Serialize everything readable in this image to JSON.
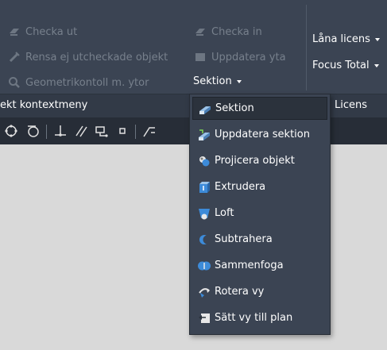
{
  "ribbon": {
    "left_items": [
      {
        "label": "Checka ut",
        "icon": "checkout-icon"
      },
      {
        "label": "Rensa ej utcheckade objekt",
        "icon": "clear-icon"
      },
      {
        "label": "Geometrikontoll m. ytor",
        "icon": "magnifier-icon"
      }
    ],
    "middle_items": [
      {
        "label": "Checka in",
        "icon": "checkin-icon"
      },
      {
        "label": "Uppdatera yta",
        "icon": "update-surface-icon"
      }
    ],
    "sektion_button": "Sektion",
    "right_items": [
      {
        "label": "Låna licens"
      },
      {
        "label": "Focus Total"
      }
    ]
  },
  "panel_labels": {
    "left": "ekt kontextmeny",
    "right": "Licens"
  },
  "menu": {
    "items": [
      {
        "label": "Sektion",
        "icon": "section-icon",
        "selected": true
      },
      {
        "label": "Uppdatera sektion",
        "icon": "update-section-icon",
        "selected": false
      },
      {
        "label": "Projicera objekt",
        "icon": "project-object-icon",
        "selected": false
      },
      {
        "label": "Extrudera",
        "icon": "extrude-icon",
        "selected": false
      },
      {
        "label": "Loft",
        "icon": "loft-icon",
        "selected": false
      },
      {
        "label": "Subtrahera",
        "icon": "subtract-icon",
        "selected": false
      },
      {
        "label": "Sammenfoga",
        "icon": "union-icon",
        "selected": false
      },
      {
        "label": "Rotera vy",
        "icon": "rotate-view-icon",
        "selected": false
      },
      {
        "label": "Sätt vy till plan",
        "icon": "set-view-plan-icon",
        "selected": false
      }
    ]
  },
  "colors": {
    "ribbon_bg": "#3b4453",
    "panelbar_bg": "#323a47",
    "toolbar_bg": "#272d37",
    "canvas_bg": "#d9d9d9",
    "disabled_text": "#77808c",
    "accent_blue": "#3d8bd9"
  }
}
